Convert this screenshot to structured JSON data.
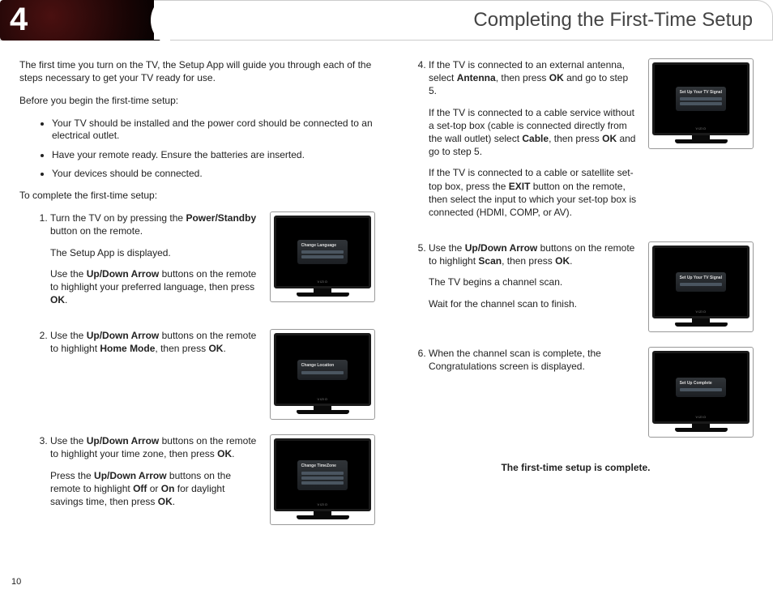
{
  "header": {
    "chapter": "4",
    "title": "Completing the First-Time Setup"
  },
  "intro": {
    "p1": "The first time you turn on the TV, the Setup App will guide you through each of the steps necessary to get your TV ready for use.",
    "p2": "Before you begin the first-time setup:",
    "bullets": [
      "Your TV should be installed and the power cord should be connected to an electrical outlet.",
      "Have your remote ready. Ensure the batteries are inserted.",
      "Your devices should be connected."
    ],
    "p3": "To complete the first-time setup:"
  },
  "steps": {
    "s1a": "Turn the TV on by pressing the ",
    "s1b": "Power/Standby",
    "s1c": " button on the remote.",
    "s1d": "The Setup App is displayed.",
    "s1e": "Use the ",
    "s1f": "Up/Down Arrow",
    "s1g": " buttons on the remote to highlight your preferred language, then press ",
    "s1h": "OK",
    "s1i": ".",
    "s2a": "Use the ",
    "s2b": "Up/Down Arrow",
    "s2c": " buttons on the remote to highlight ",
    "s2d": "Home Mode",
    "s2e": ", then press ",
    "s2f": "OK",
    "s2g": ".",
    "s3a": "Use the ",
    "s3b": "Up/Down Arrow",
    "s3c": " buttons on the remote to highlight your time zone, then press ",
    "s3d": "OK",
    "s3e": ".",
    "s3f": "Press the ",
    "s3g": "Up/Down Arrow",
    "s3h": " buttons on the remote to highlight ",
    "s3i": "Off",
    "s3j": " or ",
    "s3k": "On",
    "s3l": " for daylight savings time, then press ",
    "s3m": "OK",
    "s3n": ".",
    "s4a": "If the TV is connected to an external antenna, select ",
    "s4b": "Antenna",
    "s4c": ", then press ",
    "s4d": "OK",
    "s4e": " and go to step 5.",
    "s4f": "If the TV is connected to a cable service without a set-top box (cable is connected directly from the wall outlet) select ",
    "s4g": "Cable",
    "s4h": ", then press ",
    "s4i": "OK",
    "s4j": " and go to step 5.",
    "s4k": "If the TV is connected to a cable or satellite set-top box, press the ",
    "s4l": "EXIT",
    "s4m": " button on the remote, then select the input to which your set-top box is connected (HDMI, COMP, or AV).",
    "s5a": "Use the ",
    "s5b": "Up/Down Arrow",
    "s5c": " buttons on the remote to highlight ",
    "s5d": "Scan",
    "s5e": ", then press ",
    "s5f": "OK",
    "s5g": ".",
    "s5h": "The TV begins a channel scan.",
    "s5i": "Wait for the channel scan to finish.",
    "s6a": "When the channel scan is complete, the Congratulations screen is displayed."
  },
  "tv_menus": {
    "m1": "Change Language",
    "m2": "Change Location",
    "m3": "Change TimeZone",
    "m4": "Set Up Your TV Signal",
    "m5": "Set Up Your TV Signal",
    "m6": "Set Up Complete"
  },
  "complete": "The first-time setup is complete.",
  "page_number": "10",
  "tv_brand": "VIZIO"
}
